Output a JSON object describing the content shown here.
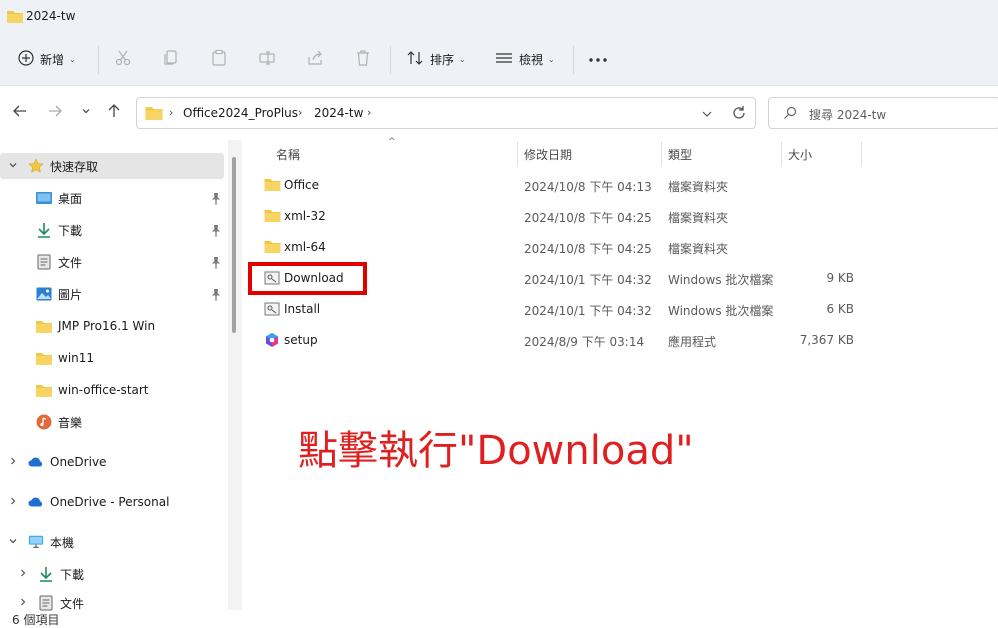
{
  "window": {
    "title": "2024-tw"
  },
  "toolbar": {
    "new_label": "新增",
    "sort_label": "排序",
    "view_label": "檢視"
  },
  "address": {
    "crumbs": [
      "Office2024_ProPlus",
      "2024-tw"
    ]
  },
  "search": {
    "placeholder": "搜尋 2024-tw"
  },
  "sidebar": {
    "quick_access": {
      "label": "快速存取",
      "items": [
        {
          "label": "桌面",
          "icon": "desktop-icon",
          "pinned": true
        },
        {
          "label": "下載",
          "icon": "download-icon",
          "pinned": true
        },
        {
          "label": "文件",
          "icon": "document-icon",
          "pinned": true
        },
        {
          "label": "圖片",
          "icon": "picture-icon",
          "pinned": true
        },
        {
          "label": "JMP Pro16.1 Win",
          "icon": "folder-icon",
          "pinned": false
        },
        {
          "label": "win11",
          "icon": "folder-icon",
          "pinned": false
        },
        {
          "label": "win-office-start",
          "icon": "folder-icon",
          "pinned": false
        },
        {
          "label": "音樂",
          "icon": "music-icon",
          "pinned": false
        }
      ]
    },
    "onedrive": "OneDrive",
    "onedrive_personal": "OneDrive - Personal",
    "this_pc": {
      "label": "本機",
      "items": [
        {
          "label": "下載",
          "icon": "download-icon"
        },
        {
          "label": "文件",
          "icon": "document-icon"
        }
      ]
    }
  },
  "columns": {
    "name": "名稱",
    "date": "修改日期",
    "type": "類型",
    "size": "大小"
  },
  "files": [
    {
      "name": "Office",
      "date": "2024/10/8 下午 04:13",
      "type": "檔案資料夾",
      "size": "",
      "icon": "folder-icon"
    },
    {
      "name": "xml-32",
      "date": "2024/10/8 下午 04:25",
      "type": "檔案資料夾",
      "size": "",
      "icon": "folder-icon"
    },
    {
      "name": "xml-64",
      "date": "2024/10/8 下午 04:25",
      "type": "檔案資料夾",
      "size": "",
      "icon": "folder-icon"
    },
    {
      "name": "Download",
      "date": "2024/10/1 下午 04:32",
      "type": "Windows 批次檔案",
      "size": "9 KB",
      "icon": "batch-file-icon"
    },
    {
      "name": "Install",
      "date": "2024/10/1 下午 04:32",
      "type": "Windows 批次檔案",
      "size": "6 KB",
      "icon": "batch-file-icon"
    },
    {
      "name": "setup",
      "date": "2024/8/9 下午 03:14",
      "type": "應用程式",
      "size": "7,367 KB",
      "icon": "office-setup-icon"
    }
  ],
  "annotation": "點擊執行\"Download\"",
  "status": {
    "count": "6 個項目"
  },
  "colors": {
    "highlight_red": "#e00000",
    "annotation_red": "#e02020",
    "folder_yellow": "#f2c744"
  }
}
